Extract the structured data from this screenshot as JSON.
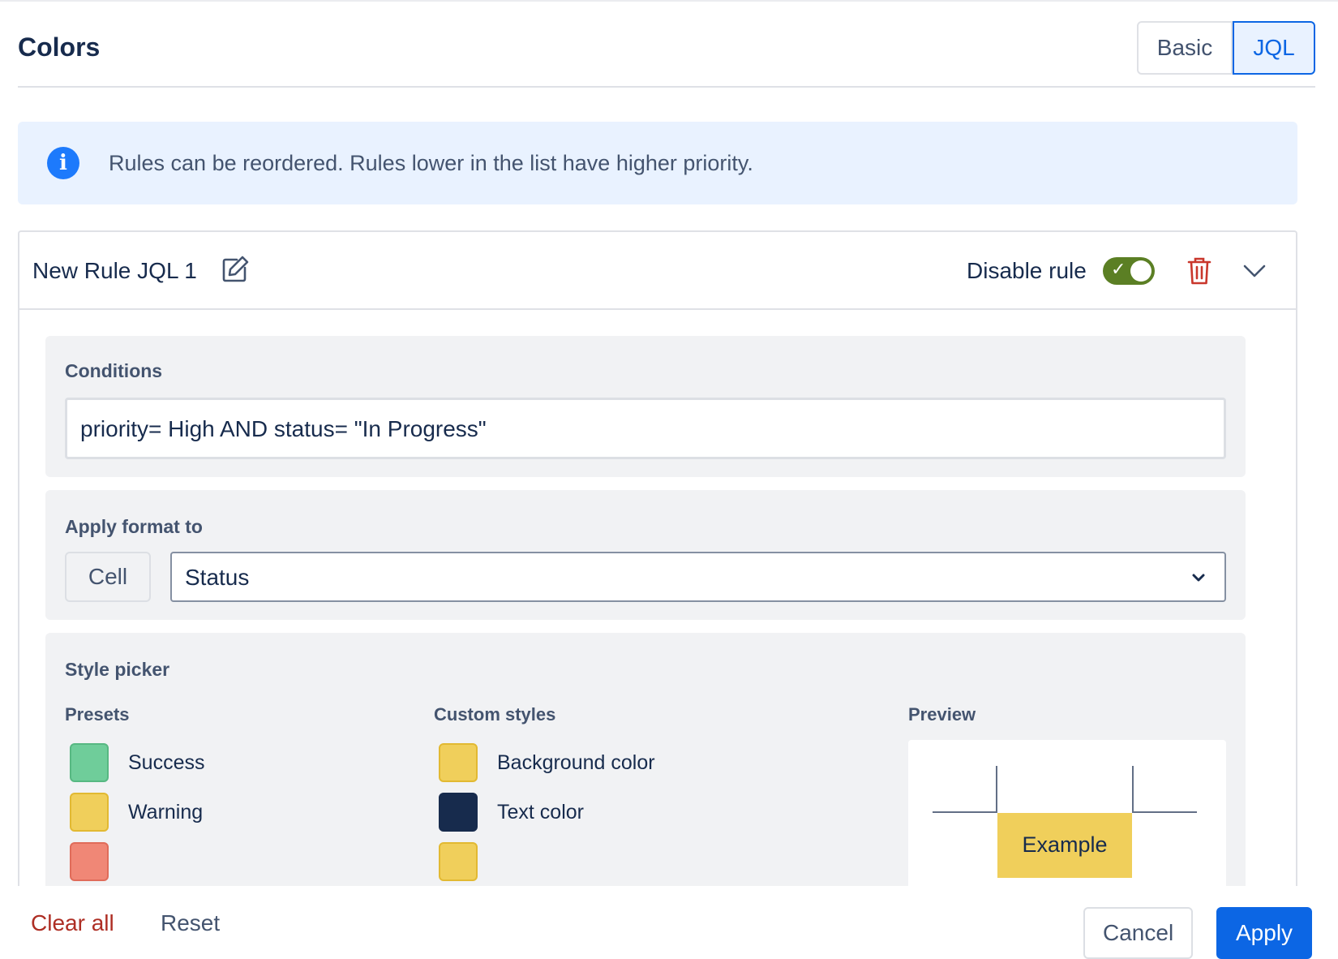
{
  "header": {
    "title": "Colors",
    "modes": [
      "Basic",
      "JQL"
    ],
    "active_mode": "JQL"
  },
  "info": {
    "text": "Rules can be reordered. Rules lower in the list have higher priority.",
    "icon": "info-icon"
  },
  "rule": {
    "name": "New Rule JQL 1",
    "disable_label": "Disable rule",
    "toggle_on": true,
    "conditions": {
      "title": "Conditions",
      "value": "priority= High AND status= \"In Progress\""
    },
    "apply_format": {
      "title": "Apply format to",
      "scope": "Cell",
      "field": "Status"
    },
    "style_picker": {
      "title": "Style picker",
      "presets": {
        "title": "Presets",
        "items": [
          {
            "label": "Success",
            "color": "#6fcd9a"
          },
          {
            "label": "Warning",
            "color": "#f0cf5b"
          },
          {
            "label": "",
            "color": "#f08776"
          }
        ]
      },
      "custom": {
        "title": "Custom styles",
        "items": [
          {
            "label": "Background color",
            "color": "#f0cf5b"
          },
          {
            "label": "Text color",
            "color": "#172b4d"
          },
          {
            "label": "",
            "color": "#f0cf5b"
          }
        ]
      },
      "preview": {
        "title": "Preview",
        "example": "Example",
        "bg": "#f0cf5b"
      }
    }
  },
  "footer": {
    "clear_all": "Clear all",
    "reset": "Reset",
    "cancel": "Cancel",
    "apply": "Apply"
  },
  "colors": {
    "accent": "#0c66e4",
    "danger": "#ae2e24",
    "toggle": "#5b7f24"
  }
}
